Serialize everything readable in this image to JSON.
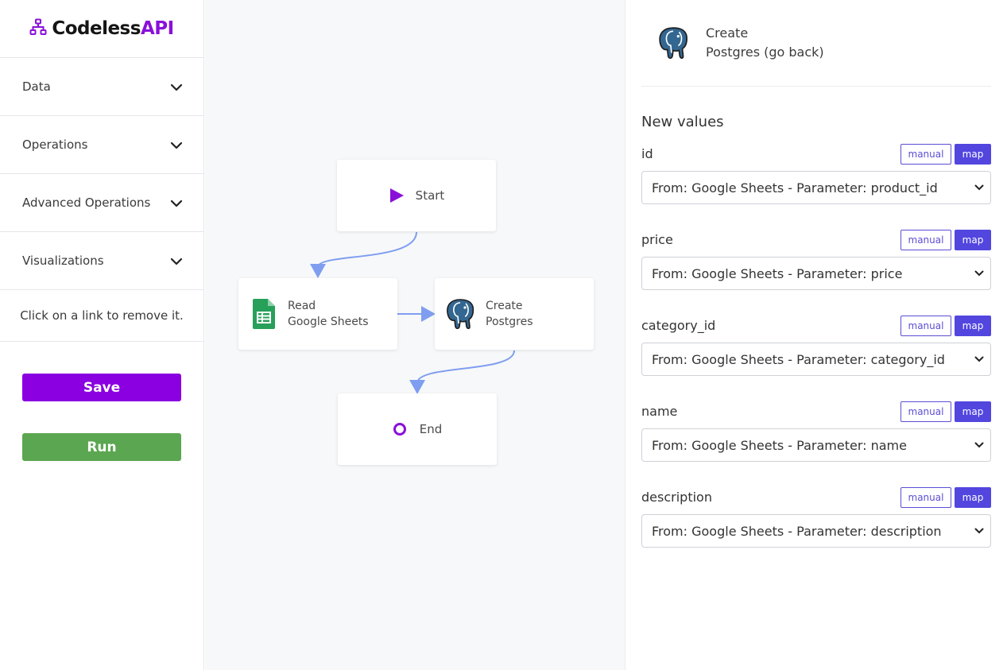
{
  "app": {
    "logo_text_1": "Codeless",
    "logo_text_2": "API",
    "logo_icon": "sitemap-icon",
    "brand_color": "#8a10d8"
  },
  "sidebar": {
    "items": [
      {
        "label": "Data",
        "icon": "chevron-down-icon"
      },
      {
        "label": "Operations",
        "icon": "chevron-down-icon"
      },
      {
        "label": "Advanced Operations",
        "icon": "chevron-down-icon"
      },
      {
        "label": "Visualizations",
        "icon": "chevron-down-icon"
      }
    ],
    "hint": "Click on a link to remove it.",
    "save_label": "Save",
    "run_label": "Run"
  },
  "flow": {
    "nodes": {
      "start": {
        "label": "Start",
        "icon": "play-icon"
      },
      "read": {
        "line1": "Read",
        "line2": "Google Sheets",
        "icon": "google-sheets-icon"
      },
      "create": {
        "line1": "Create",
        "line2": "Postgres",
        "icon": "postgres-elephant-icon"
      },
      "end": {
        "label": "End",
        "icon": "circle-icon"
      }
    },
    "edge_color": "#7f9ef0"
  },
  "panel": {
    "header_line1": "Create",
    "header_line2": "Postgres (go back)",
    "section_title": "New values",
    "manual_label": "manual",
    "map_label": "map",
    "fields": [
      {
        "name": "id",
        "value": "From: Google Sheets - Parameter: product_id"
      },
      {
        "name": "price",
        "value": "From: Google Sheets - Parameter: price"
      },
      {
        "name": "category_id",
        "value": "From: Google Sheets - Parameter: category_id"
      },
      {
        "name": "name",
        "value": "From: Google Sheets - Parameter: name"
      },
      {
        "name": "description",
        "value": "From: Google Sheets - Parameter: description"
      }
    ]
  }
}
